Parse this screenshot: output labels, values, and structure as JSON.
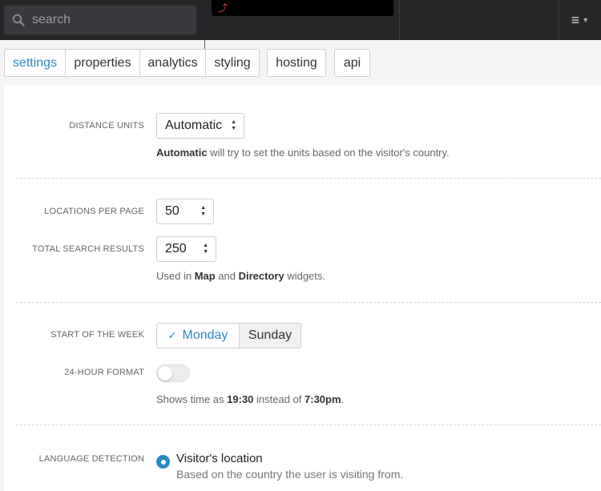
{
  "search": {
    "placeholder": "search"
  },
  "tabs": {
    "group1": [
      "settings",
      "properties",
      "analytics",
      "styling"
    ],
    "hosting": "hosting",
    "api": "api",
    "active": "settings"
  },
  "distance_units": {
    "label": "DISTANCE UNITS",
    "value": "Automatic",
    "help_bold": "Automatic",
    "help_rest": " will try to set the units based on the visitor's country."
  },
  "locations_per_page": {
    "label": "LOCATIONS PER PAGE",
    "value": "50"
  },
  "total_search_results": {
    "label": "TOTAL SEARCH RESULTS",
    "value": "250",
    "help_prefix": "Used in ",
    "help_bold1": "Map",
    "help_mid": " and ",
    "help_bold2": "Directory",
    "help_suffix": " widgets."
  },
  "start_of_week": {
    "label": "START OF THE WEEK",
    "options": [
      "Monday",
      "Sunday"
    ],
    "selected": "Monday"
  },
  "hour_format": {
    "label": "24-HOUR FORMAT",
    "enabled": false,
    "help_prefix": "Shows time as ",
    "help_bold1": "19:30",
    "help_mid": " instead of ",
    "help_bold2": "7:30pm",
    "help_suffix": "."
  },
  "language_detection": {
    "label": "LANGUAGE DETECTION",
    "option_title": "Visitor's location",
    "option_desc": "Based on the country the user is visiting from."
  },
  "colors": {
    "accent": "#2a8ac0",
    "topbar": "#262629"
  },
  "icons": {
    "search": "search-icon",
    "menu": "hamburger-menu-icon",
    "check": "checkmark-icon"
  }
}
